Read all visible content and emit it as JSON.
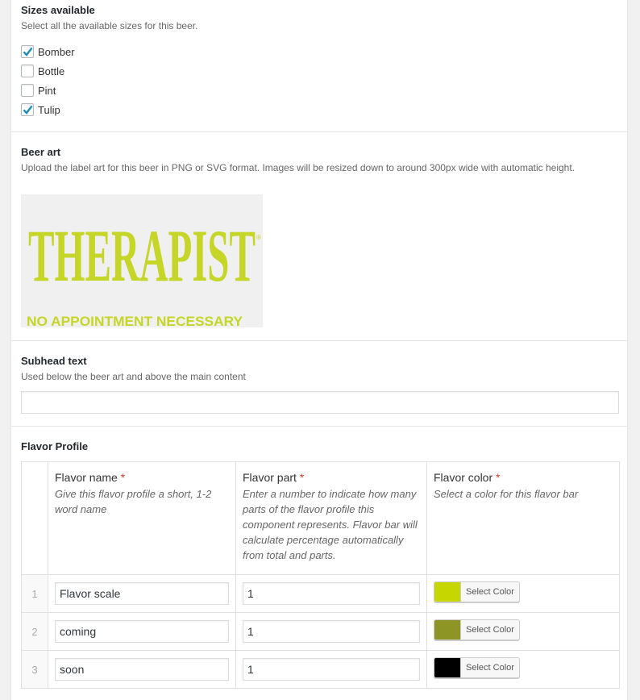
{
  "sizes": {
    "label": "Sizes available",
    "description": "Select all the available sizes for this beer.",
    "options": [
      {
        "label": "Bomber",
        "checked": true
      },
      {
        "label": "Bottle",
        "checked": false
      },
      {
        "label": "Pint",
        "checked": false
      },
      {
        "label": "Tulip",
        "checked": true
      }
    ]
  },
  "beer_art": {
    "label": "Beer art",
    "description": "Upload the label art for this beer in PNG or SVG format. Images will be resized down to around 300px wide with automatic height.",
    "image": {
      "title": "THERAPIST",
      "tagline": "NO APPOINTMENT NECESSARY",
      "mark": "®",
      "color": "#c5d629",
      "background": "#f0f0f0"
    }
  },
  "subhead": {
    "label": "Subhead text",
    "description": "Used below the beer art and above the main content",
    "value": ""
  },
  "flavor_profile": {
    "label": "Flavor Profile",
    "required_mark": "*",
    "columns": [
      {
        "label": "Flavor name",
        "instructions": "Give this flavor profile a short, 1-2 word name"
      },
      {
        "label": "Flavor part",
        "instructions": "Enter a number to indicate how many parts of the flavor profile this component represents. Flavor bar will calculate percentage automatically from total and parts."
      },
      {
        "label": "Flavor color",
        "instructions": "Select a color for this flavor bar"
      }
    ],
    "select_color_label": "Select Color",
    "rows": [
      {
        "order": "1",
        "name": "Flavor scale",
        "part": "1",
        "color": "#c5d600"
      },
      {
        "order": "2",
        "name": "coming",
        "part": "1",
        "color": "#8d9524"
      },
      {
        "order": "3",
        "name": "soon",
        "part": "1",
        "color": "#000000"
      }
    ]
  },
  "colors": {
    "checkbox_check": "#1e8cbe",
    "required": "#dd3d36"
  }
}
